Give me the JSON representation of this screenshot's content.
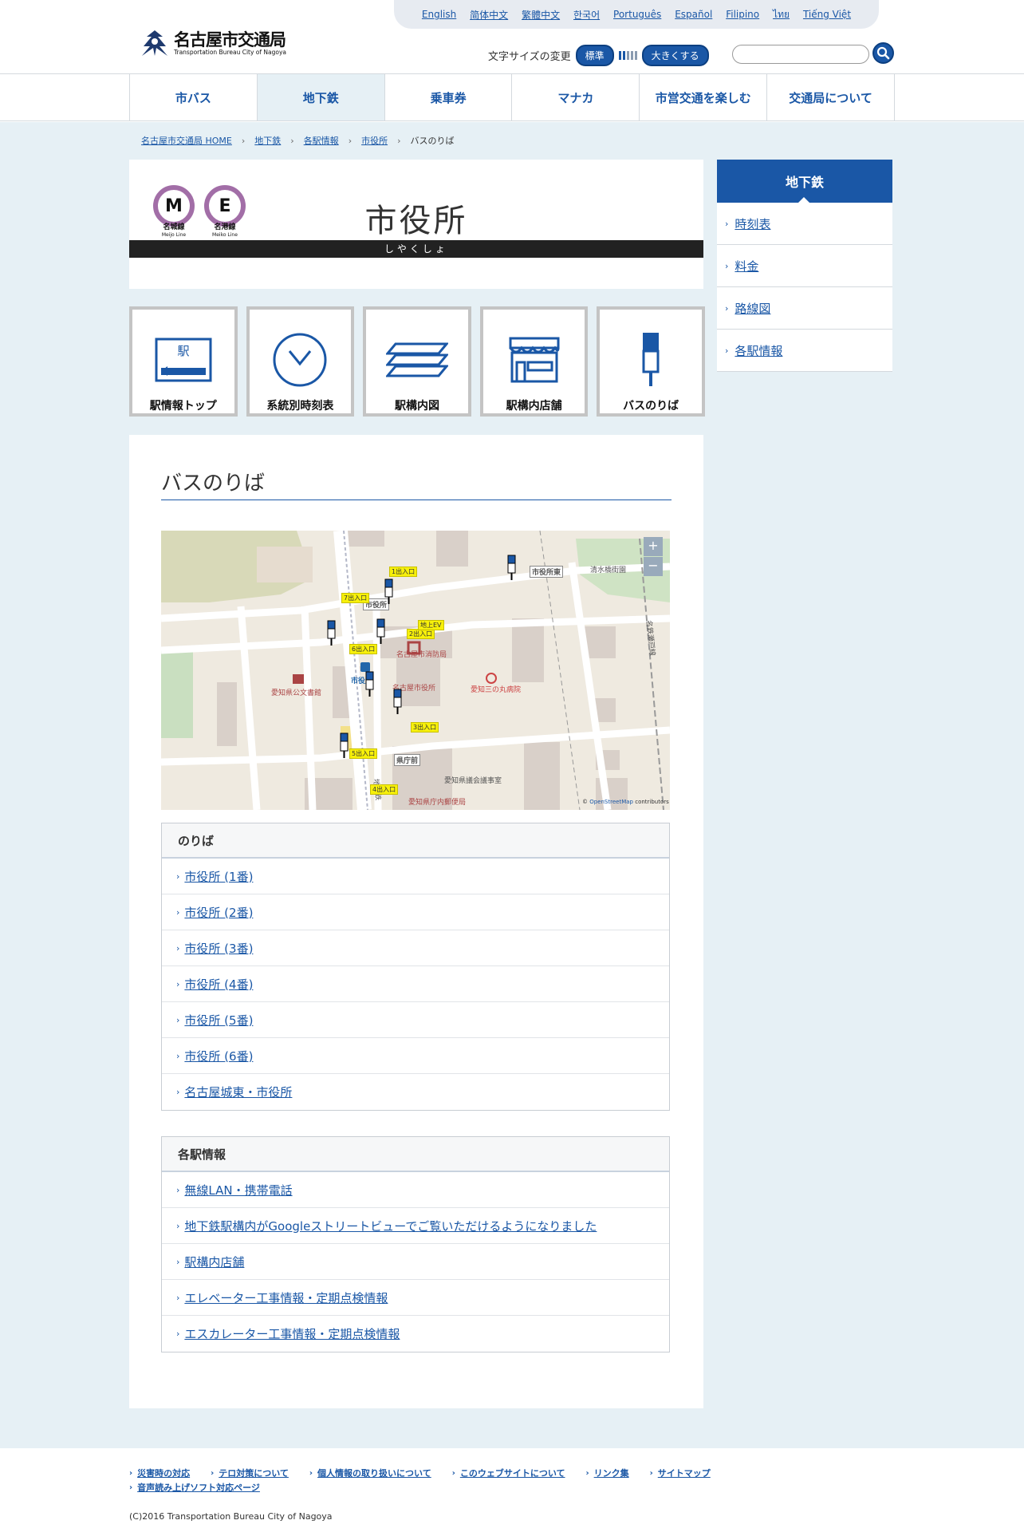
{
  "header": {
    "languages": [
      "English",
      "简体中文",
      "繁體中文",
      "한국어",
      "Português",
      "Español",
      "Filipino",
      "ไทย",
      "Tiếng Việt"
    ],
    "logo_title": "名古屋市交通局",
    "logo_sub": "Transportation Bureau City of Nagoya",
    "fontsize_label": "文字サイズの変更",
    "fontsize_standard": "標準",
    "fontsize_large": "大きくする",
    "search_placeholder": ""
  },
  "nav": [
    "市バス",
    "地下鉄",
    "乗車券",
    "マナカ",
    "市営交通を楽しむ",
    "交通局について"
  ],
  "breadcrumb": [
    "名古屋市交通局 HOME",
    "地下鉄",
    "各駅情報",
    "市役所",
    "バスのりば"
  ],
  "station": {
    "lines": [
      {
        "letter": "M",
        "name": "名城線",
        "roman": "Meijo Line"
      },
      {
        "letter": "E",
        "name": "名港線",
        "roman": "Meiko Line"
      }
    ],
    "name": "市役所",
    "kana": "しやくしょ",
    "line_color": "#a26ea7"
  },
  "tiles": [
    "駅情報トップ",
    "系統別時刻表",
    "駅構内図",
    "駅構内店舗",
    "バスのりば"
  ],
  "tile_icons": [
    "station-sign-icon",
    "clock-icon",
    "layers-icon",
    "shop-icon",
    "bus-stop-icon"
  ],
  "sidebar": {
    "title": "地下鉄",
    "items": [
      "時刻表",
      "料金",
      "路線図",
      "各駅情報"
    ]
  },
  "page_title": "バスのりば",
  "map": {
    "zoom_in": "+",
    "zoom_out": "−",
    "attribution_prefix": "©",
    "attribution_link": "OpenStreetMap",
    "attribution_suffix": "contributors",
    "labels": {
      "shiyakusho_east": "市役所東",
      "shimizubashi": "清水橋街園",
      "shiyakusho": "市役所",
      "shiyakusho_sta": "市役所",
      "kenchomae": "県庁前",
      "fire": "名古屋市消防局",
      "cityhall": "名古屋市役所",
      "hospital": "愛知三の丸病院",
      "archive": "愛知県公文書館",
      "assembly": "愛知県議会議事室",
      "postoffice": "愛知県庁内郵便局",
      "subway": "地下鉄",
      "meitetsu": "名鉄瀬戸線",
      "exit1": "1出入口",
      "exit2": "2出入口",
      "exit3": "3出入口",
      "exit4": "4出入口",
      "exit5": "5出入口",
      "exit6": "6出入口",
      "exit7": "7出入口",
      "ev": "地上EV"
    }
  },
  "noriba": {
    "title": "のりば",
    "items": [
      "市役所 (1番)",
      "市役所 (2番)",
      "市役所 (3番)",
      "市役所 (4番)",
      "市役所 (5番)",
      "市役所 (6番)",
      "名古屋城東・市役所"
    ]
  },
  "station_info": {
    "title": "各駅情報",
    "items": [
      "無線LAN・携帯電話",
      "地下鉄駅構内がGoogleストリートビューでご覧いただけるようになりました",
      "駅構内店舗",
      "エレベーター工事情報・定期点検情報",
      "エスカレーター工事情報・定期点検情報"
    ]
  },
  "footer": {
    "links": [
      "災害時の対応",
      "テロ対策について",
      "個人情報の取り扱いについて",
      "このウェブサイトについて",
      "リンク集",
      "サイトマップ",
      "音声読み上げソフト対応ページ"
    ],
    "copyright": "(C)2016 Transportation Bureau City of Nagoya"
  },
  "colors": {
    "brand": "#1a57a6",
    "page_bg": "#e6f0f5",
    "line": "#a26ea7"
  }
}
